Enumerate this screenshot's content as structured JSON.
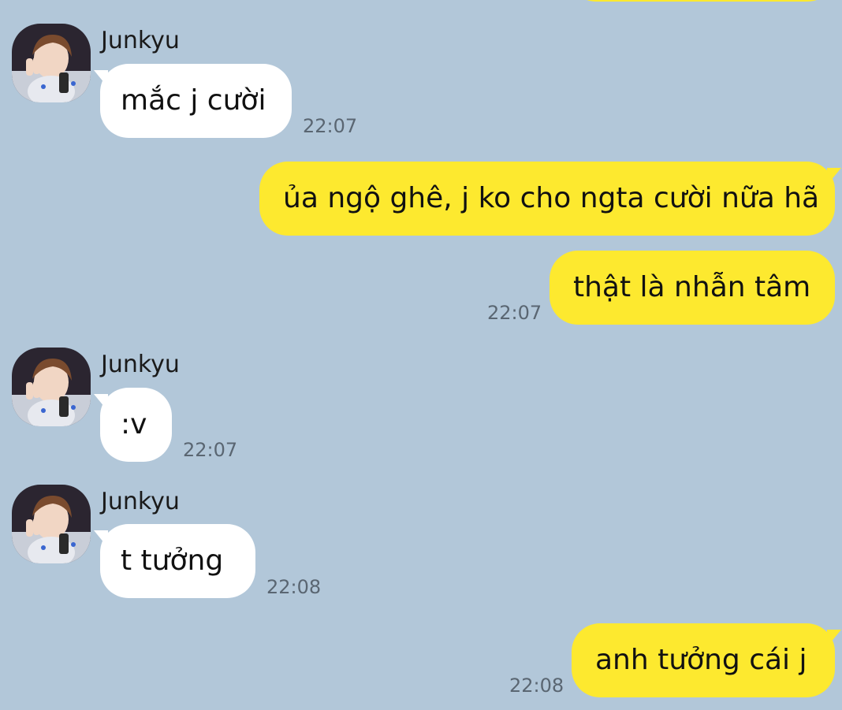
{
  "messages": [
    {
      "sender": "Junkyu",
      "text": "mắc j cười",
      "time": "22:07",
      "direction": "in"
    },
    {
      "text": "ủa ngộ ghê, j ko cho ngta cười nữa hã",
      "direction": "out"
    },
    {
      "text": "thật là nhẫn tâm",
      "time": "22:07",
      "direction": "out"
    },
    {
      "sender": "Junkyu",
      "text": ":v",
      "time": "22:07",
      "direction": "in"
    },
    {
      "sender": "Junkyu",
      "text": "t tưởng",
      "time": "22:08",
      "direction": "in"
    },
    {
      "text": "anh tưởng cái j",
      "time": "22:08",
      "direction": "out"
    }
  ],
  "colors": {
    "background": "#b2c7d9",
    "incoming_bubble": "#ffffff",
    "outgoing_bubble": "#fde92f"
  },
  "icons": {
    "avatar": "profile-photo-peace-sign"
  }
}
